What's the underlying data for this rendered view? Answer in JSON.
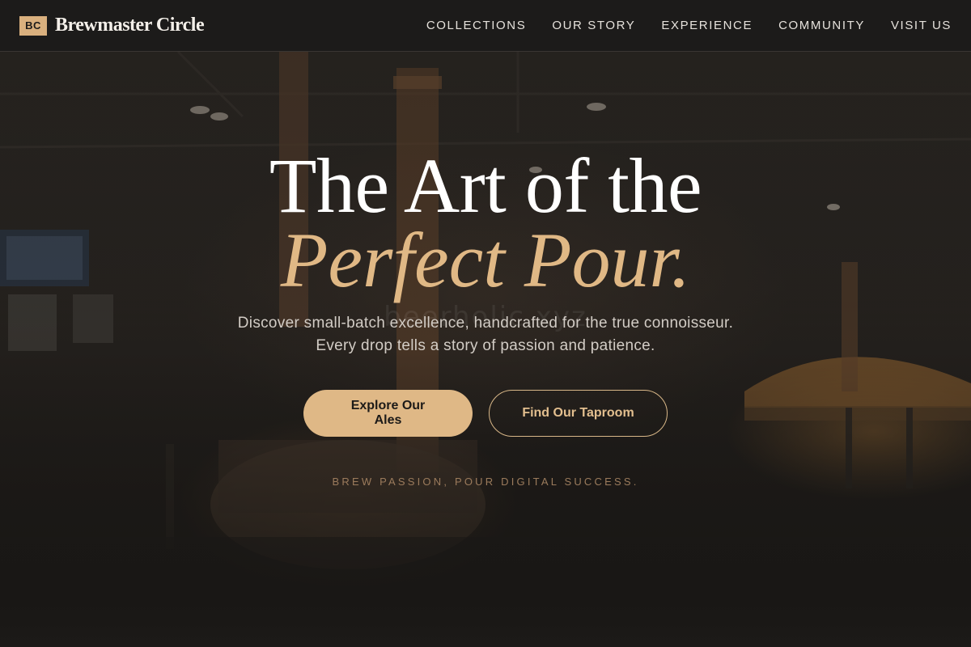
{
  "brand": {
    "badge": "BC",
    "name": "Brewmaster Circle"
  },
  "nav": {
    "items": [
      {
        "label": "COLLECTIONS"
      },
      {
        "label": "OUR STORY"
      },
      {
        "label": "EXPERIENCE"
      },
      {
        "label": "COMMUNITY"
      },
      {
        "label": "VISIT US"
      }
    ]
  },
  "hero": {
    "headline_line1": "The Art of the",
    "headline_line2": "Perfect Pour.",
    "subtitle": "Discover small-batch excellence, handcrafted for the true connoisseur. Every drop tells a story of passion and patience.",
    "primary_cta": "Explore Our Ales",
    "secondary_cta": "Find Our Taproom",
    "tagline": "BREW PASSION, POUR DIGITAL SUCCESS.",
    "watermark": "beerholic.xyz"
  },
  "colors": {
    "accent": "#dfb886",
    "navbar_bg": "#1c1b1a",
    "headline": "#ffffff",
    "headline_accent": "#e0b885",
    "tagline": "#9b7b5c"
  }
}
